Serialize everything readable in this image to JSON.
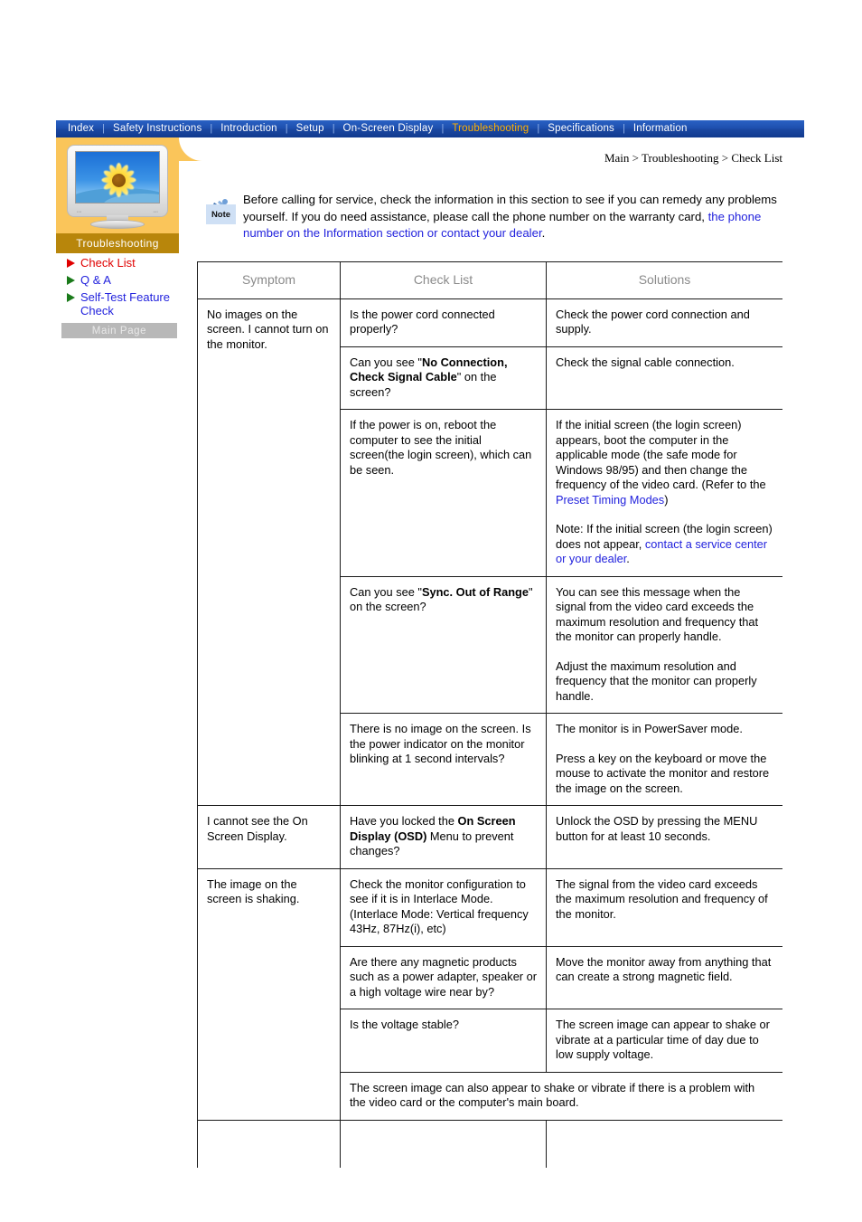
{
  "nav": {
    "items": [
      {
        "label": "Index",
        "active": false
      },
      {
        "label": "Safety Instructions",
        "active": false
      },
      {
        "label": "Introduction",
        "active": false
      },
      {
        "label": "Setup",
        "active": false
      },
      {
        "label": "On-Screen Display",
        "active": false
      },
      {
        "label": "Troubleshooting",
        "active": true
      },
      {
        "label": "Specifications",
        "active": false
      },
      {
        "label": "Information",
        "active": false
      }
    ],
    "separator": "|",
    "active_color": "#ffb000",
    "bar_color": "#1a47a0"
  },
  "sidebar": {
    "thumb_label": "Troubleshooting",
    "thumb_icon": "crt-monitor-sunflower-icon",
    "items": [
      {
        "label": "Check List",
        "state": "current",
        "bullet": "triangle-right-red",
        "color": "#e00000"
      },
      {
        "label": "Q & A",
        "state": "link",
        "bullet": "triangle-right-green",
        "color": "#2222dd"
      },
      {
        "label": "Self-Test Feature Check",
        "state": "link",
        "bullet": "triangle-right-green",
        "color": "#2222dd"
      }
    ],
    "main_page_button": "Main Page"
  },
  "breadcrumb": "Main > Troubleshooting > Check List",
  "note": {
    "icon_label": "Note",
    "icon_name": "pushpin-note-icon",
    "text_part1": "Before calling for service, check the information in this section to see if you can remedy any problems yourself. If you do need assistance, please call the phone number on the warranty card, ",
    "link": "the phone number on the Information section or contact your dealer",
    "text_part2": "."
  },
  "table": {
    "headers": [
      "Symptom",
      "Check List",
      "Solutions"
    ],
    "rows": [
      {
        "symptom": "No images on the screen. I cannot turn on the monitor.",
        "check": "Is the power cord connected properly?",
        "solution": "Check the power cord connection and supply."
      },
      {
        "symptom": "",
        "check_pre": "Can you see \"",
        "check_bold": "No Connection, Check Signal Cable",
        "check_post": "\" on the screen?",
        "solution": "Check the signal cable connection."
      },
      {
        "symptom": "",
        "check": "If the power is on, reboot the computer to see the initial screen(the login screen), which can be seen.",
        "solution_p1": "If the initial screen (the login screen) appears, boot the computer in the applicable mode (the safe mode for Windows 98/95) and then change the frequency of the video card. (Refer to the ",
        "solution_link1": "Preset Timing Modes",
        "solution_p2": ")",
        "solution_p3": "Note: If the initial screen (the login screen) does not appear, ",
        "solution_link2": "contact a service center or your dealer",
        "solution_p4": "."
      },
      {
        "symptom": "",
        "check_pre": "Can you see \"",
        "check_bold": "Sync. Out of Range",
        "check_post": "\" on the screen?",
        "solution_p1": "You can see this message when the signal from the video card exceeds the maximum resolution and frequency that the monitor can properly handle.",
        "solution_p2": "Adjust the maximum resolution and frequency that the monitor can properly handle."
      },
      {
        "symptom": "",
        "check": "There is no image on the screen. Is the power indicator on the monitor blinking at 1 second intervals?",
        "solution_p1": "The monitor is in PowerSaver mode.",
        "solution_p2": "Press a key on the keyboard or move the mouse to activate the monitor and restore the image on the screen."
      },
      {
        "symptom": "I cannot see the On Screen Display.",
        "check_pre": "Have you locked the ",
        "check_bold": "On Screen Display (OSD)",
        "check_post": " Menu to prevent changes?",
        "solution": "Unlock the OSD by pressing the MENU button for at least 10 seconds."
      },
      {
        "symptom": "The image on the screen is shaking.",
        "check": "Check the monitor configuration to see if it is in Interlace Mode. (Interlace Mode: Vertical frequency 43Hz, 87Hz(i), etc)",
        "solution": "The signal from the video card exceeds the maximum resolution and frequency of the monitor."
      },
      {
        "symptom": "",
        "check": "Are there any magnetic products such as a power adapter, speaker or a high voltage wire near by?",
        "solution": "Move the monitor away from anything that can create a strong magnetic field."
      },
      {
        "symptom": "",
        "check": "Is the voltage stable?",
        "solution": "The screen image can appear to shake or vibrate at a particular time of day due to low supply voltage."
      }
    ],
    "merged_note_row": "The screen image can also appear to shake or vibrate if there is a problem with the video card or the computer's main board."
  }
}
